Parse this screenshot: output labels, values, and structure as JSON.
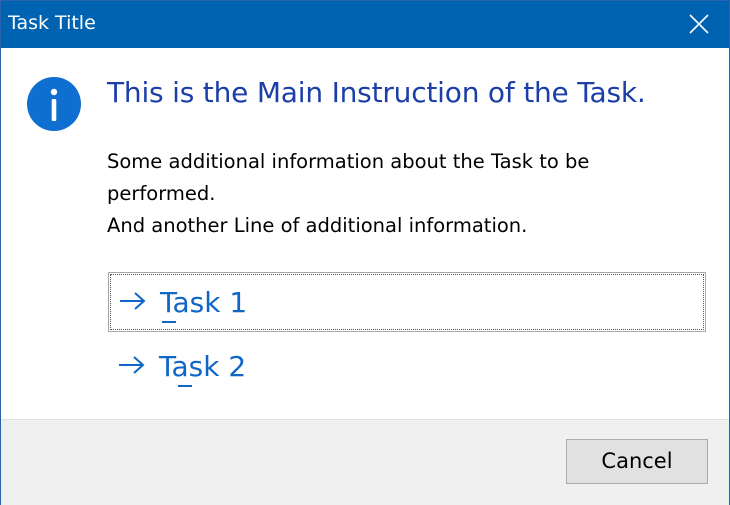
{
  "window": {
    "title": "Task Title"
  },
  "content": {
    "main_instruction": "This is the Main Instruction of the Task.",
    "text_lines": [
      "Some additional information about the Task to be",
      "performed.",
      "And another Line of additional information."
    ]
  },
  "command_links": [
    {
      "label": "Task 1",
      "mnemonic": "T",
      "focused": true
    },
    {
      "label": "Task 2",
      "mnemonic": "a",
      "focused": false
    }
  ],
  "footer": {
    "cancel_label": "Cancel"
  },
  "icons": {
    "info": "information-icon",
    "close": "close-icon",
    "arrow": "right-arrow-icon"
  },
  "colors": {
    "titlebar": "#0063b1",
    "main_instruction": "#1b3ea8",
    "link": "#0f66c8",
    "info_icon": "#0f6fd0",
    "footer": "#f0f0f0"
  }
}
